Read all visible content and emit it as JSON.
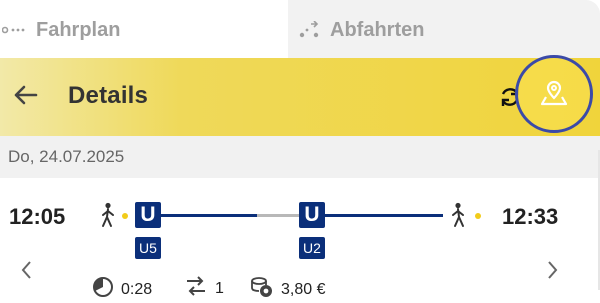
{
  "tabs": {
    "left_label": "Fahrplan",
    "right_label": "Abfahrten"
  },
  "header": {
    "title": "Details"
  },
  "date": "Do, 24.07.2025",
  "trip": {
    "departure_time": "12:05",
    "arrival_time": "12:33",
    "legs": [
      {
        "symbol": "U",
        "line": "U5"
      },
      {
        "symbol": "U",
        "line": "U2"
      }
    ],
    "duration": "0:28",
    "transfers": "1",
    "price": "3,80 €"
  },
  "colors": {
    "header_yellow": "#F0D43B",
    "ubahn_blue": "#0B2F7A",
    "highlight_ring": "#3B4AA8",
    "walk_dot": "#F2CC1A"
  }
}
